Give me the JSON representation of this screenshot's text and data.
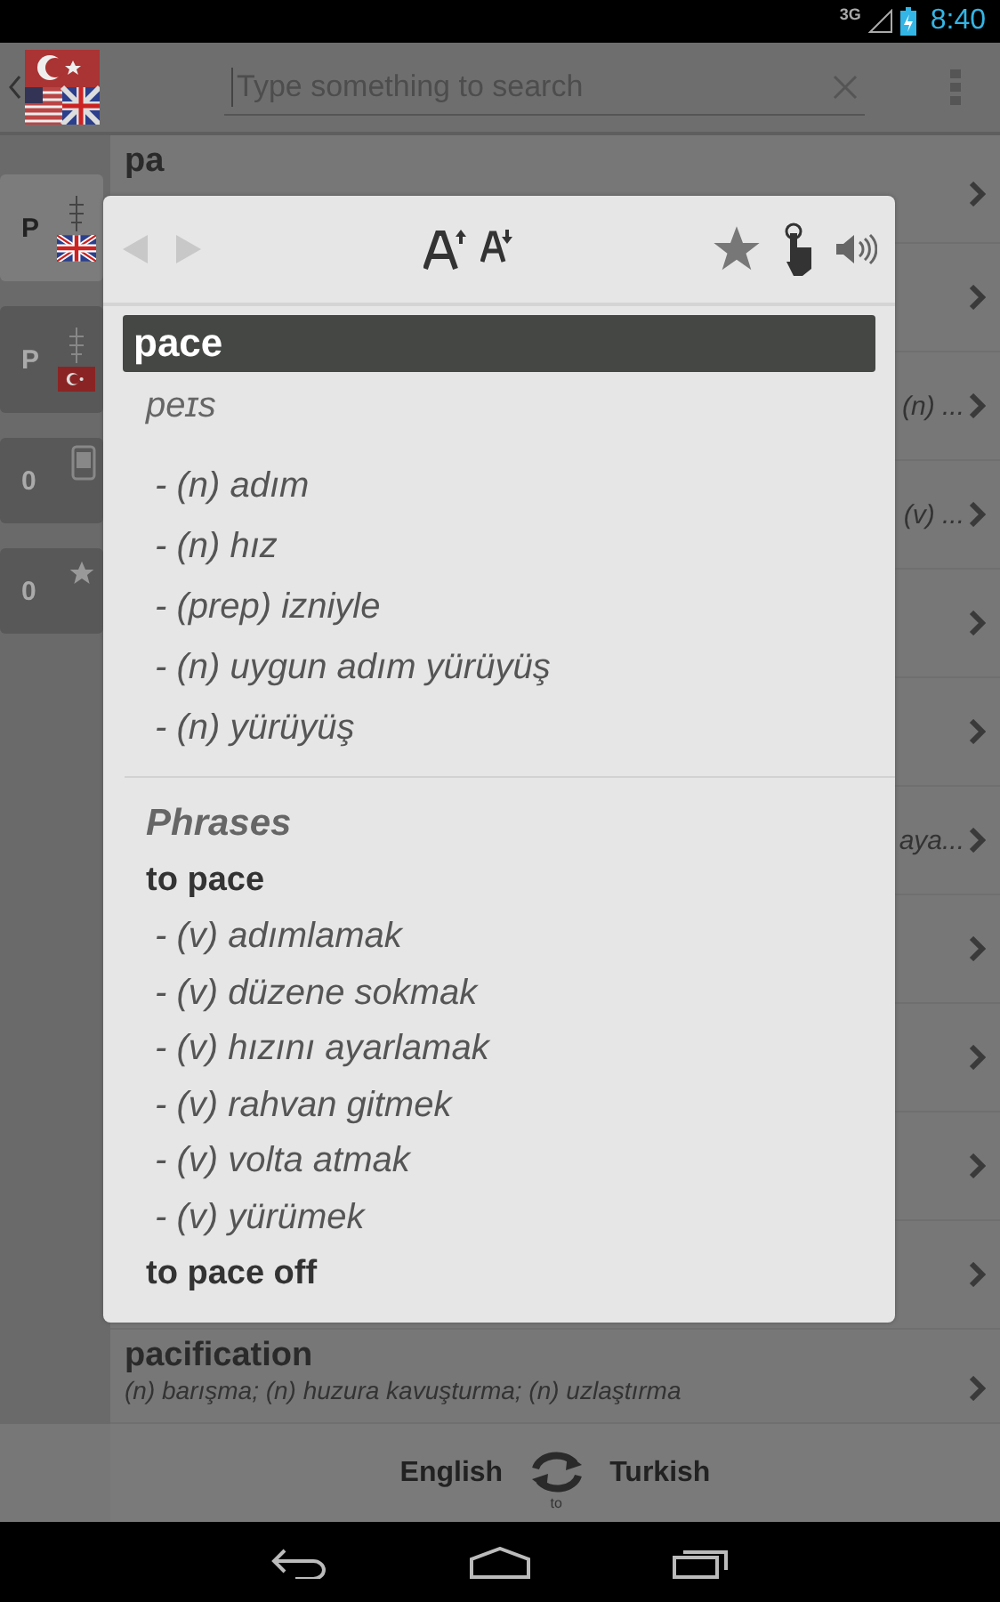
{
  "status_bar": {
    "network": "3G",
    "time": "8:40"
  },
  "search": {
    "placeholder": "Type something to search"
  },
  "sidebar": {
    "items": [
      {
        "kind": "english",
        "label": "P",
        "selected": true
      },
      {
        "kind": "turkish",
        "label": "P",
        "selected": false
      },
      {
        "kind": "history",
        "label": "0",
        "selected": false
      },
      {
        "kind": "favorites",
        "label": "0",
        "selected": false
      }
    ]
  },
  "list_rows": [
    {
      "title": "pa"
    },
    {
      "snippet": ""
    },
    {
      "snippet": "(n) ..."
    },
    {
      "snippet": "(v) ..."
    },
    {},
    {},
    {
      "snippet": "aya..."
    },
    {},
    {},
    {},
    {},
    {
      "title": "pacification",
      "snippet": "(n) barışma; (n) huzura kavuşturma; (n) uzlaştırma"
    }
  ],
  "dialog": {
    "word": "pace",
    "pronunciation": "peɪs",
    "meanings": [
      "- (n) adım",
      "- (n) hız",
      "- (prep) izniyle",
      "- (n) uygun adım yürüyüş",
      "- (n) yürüyüş"
    ],
    "phrases_heading": "Phrases",
    "phrases": [
      {
        "phrase": "to pace",
        "meanings": [
          "- (v) adımlamak",
          "- (v) düzene sokmak",
          "- (v) hızını ayarlamak",
          "- (v) rahvan gitmek",
          "- (v) volta atmak",
          "- (v) yürümek"
        ]
      },
      {
        "phrase": "to pace off"
      }
    ]
  },
  "language_bar": {
    "from": "English",
    "connector": "to",
    "to": "Turkish"
  }
}
